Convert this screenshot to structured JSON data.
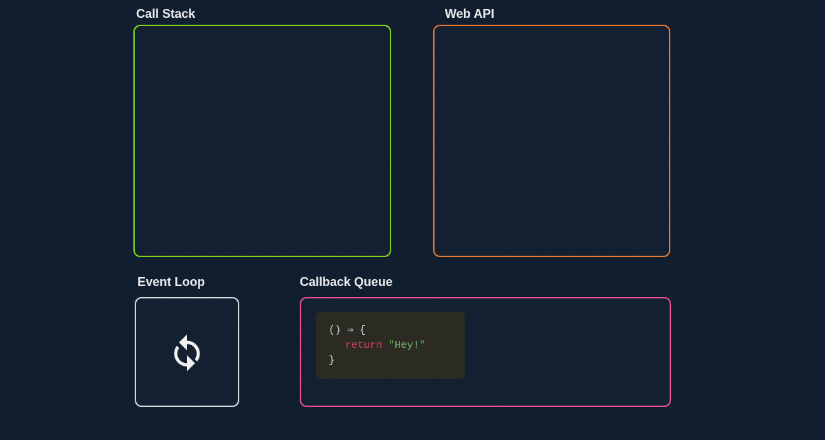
{
  "labels": {
    "call_stack": "Call Stack",
    "web_api": "Web API",
    "event_loop": "Event Loop",
    "callback_queue": "Callback Queue"
  },
  "callback_item": {
    "line1": "() ⇒ {",
    "return_kw": "return",
    "string_literal": "\"Hey!\"",
    "line3": "}"
  },
  "colors": {
    "call_stack_border": "#7fd61f",
    "web_api_border": "#ec7a2d",
    "event_loop_border": "#d7dbe0",
    "callback_queue_border": "#ef4d92",
    "background": "#0f1c2e",
    "code_card_bg": "#2b2b24"
  },
  "icons": {
    "event_loop": "cycle-arrows"
  }
}
